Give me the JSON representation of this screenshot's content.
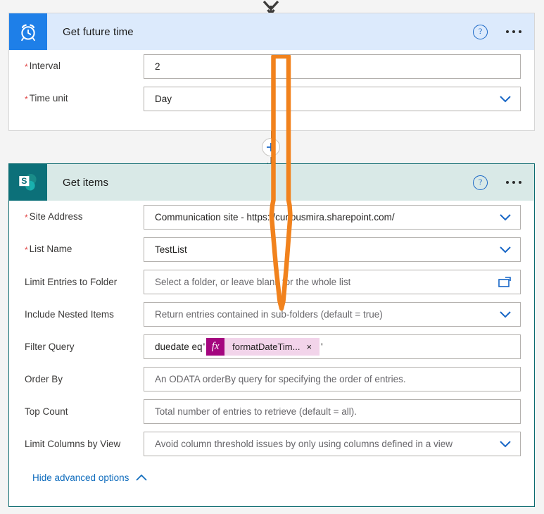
{
  "steps": [
    {
      "title": "Get future time",
      "icon": "alarm-clock-icon",
      "help_icon": "help-circle-icon",
      "more_icon": "more-ellipsis-icon",
      "fields": [
        {
          "label": "Interval",
          "required": true,
          "value": "2",
          "placeholder": "",
          "control": "text"
        },
        {
          "label": "Time unit",
          "required": true,
          "value": "Day",
          "placeholder": "",
          "control": "dropdown"
        }
      ]
    },
    {
      "title": "Get items",
      "icon": "sharepoint-icon",
      "help_icon": "help-circle-icon",
      "more_icon": "more-ellipsis-icon",
      "fields": [
        {
          "label": "Site Address",
          "required": true,
          "value": "Communication site - https://curiousmira.sharepoint.com/",
          "placeholder": "",
          "control": "dropdown"
        },
        {
          "label": "List Name",
          "required": true,
          "value": "TestList",
          "placeholder": "",
          "control": "dropdown"
        },
        {
          "label": "Limit Entries to Folder",
          "required": false,
          "value": "",
          "placeholder": "Select a folder, or leave blank for the whole list",
          "control": "folder-picker"
        },
        {
          "label": "Include Nested Items",
          "required": false,
          "value": "",
          "placeholder": "Return entries contained in sub-folders (default = true)",
          "control": "dropdown"
        },
        {
          "label": "Filter Query",
          "required": false,
          "value": "",
          "placeholder": "",
          "control": "token"
        },
        {
          "label": "Order By",
          "required": false,
          "value": "",
          "placeholder": "An ODATA orderBy query for specifying the order of entries.",
          "control": "text"
        },
        {
          "label": "Top Count",
          "required": false,
          "value": "",
          "placeholder": "Total number of entries to retrieve (default = all).",
          "control": "text"
        },
        {
          "label": "Limit Columns by View",
          "required": false,
          "value": "Avoid column threshold issues by only using columns defined in a view",
          "placeholder": "",
          "control": "dropdown"
        }
      ],
      "filter_query": {
        "prefix": "duedate eq",
        "open_quote": "'",
        "token_fx": "fx",
        "token_label": "formatDateTim...",
        "token_remove": "×",
        "close_quote": "'"
      },
      "advanced_link": {
        "label": "Hide advanced options",
        "icon": "chevron-up-icon"
      }
    }
  ],
  "connector": {
    "add_step_icon": "plus-icon",
    "flow_arrow_icon": "arrow-down-icon"
  },
  "annotation": {
    "shape": "arrow-down-outline",
    "color": "#F1821D"
  },
  "colors": {
    "future_header": "#dceafc",
    "future_icon_bg": "#1e7fe8",
    "items_header": "#d9e9e7",
    "items_icon_bg": "#0c7079",
    "items_border": "#0b6a6f",
    "link": "#0f6cbd",
    "required": "#e04545",
    "token_fx_bg": "#a4067f",
    "token_bg": "#f2d4ea",
    "annotation": "#F1821D"
  }
}
